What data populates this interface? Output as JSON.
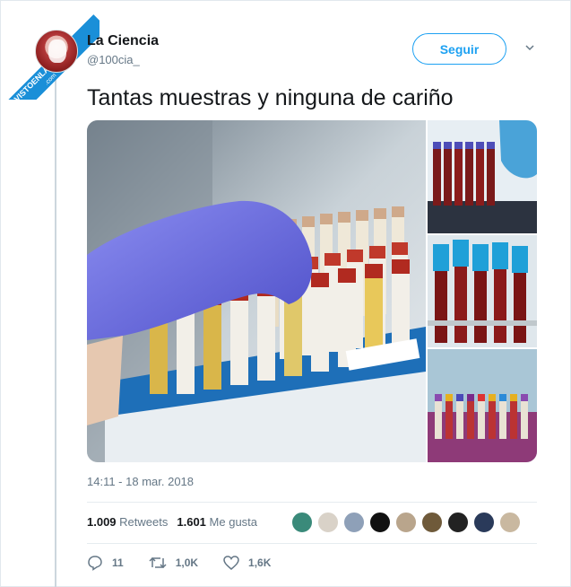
{
  "watermark": {
    "line1": "VISTOENLASREDES",
    "line2": ".com"
  },
  "tweet": {
    "author_name": "La Ciencia",
    "author_handle": "@100cia_",
    "follow_label": "Seguir",
    "text": "Tantas muestras y ninguna de cariño",
    "timestamp": "14:11 - 18 mar. 2018"
  },
  "stats": {
    "retweets_count": "1.009",
    "retweets_label": "Retweets",
    "likes_count": "1.601",
    "likes_label": "Me gusta"
  },
  "actions": {
    "replies": "11",
    "retweets": "1,0K",
    "likes": "1,6K"
  },
  "likers": [
    "#3a8a7a",
    "#d9d2c8",
    "#8ea0b8",
    "#111111",
    "#b9a58c",
    "#6f5a3a",
    "#222222",
    "#2a3a5a",
    "#c9b8a0"
  ],
  "colors": {
    "accent": "#1da1f2",
    "secondary_text": "#657786"
  }
}
